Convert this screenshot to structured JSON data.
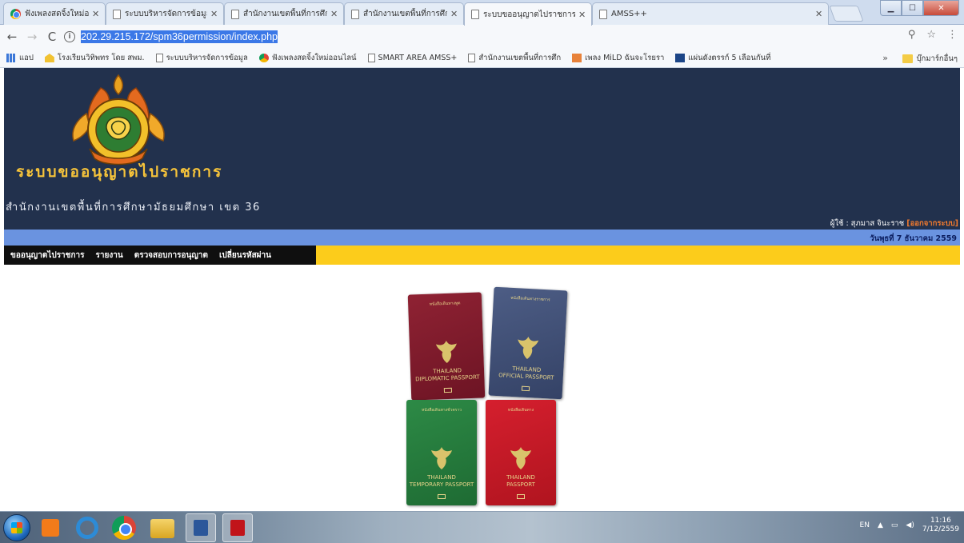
{
  "browser": {
    "tabs": [
      {
        "title": "ฟังเพลงสดจิ้งใหม่ออนไลน์",
        "favicon": "chrome-icon",
        "active": false
      },
      {
        "title": "ระบบบริหารจัดการข้อมูลโรงเรียน",
        "favicon": "document-icon",
        "active": false
      },
      {
        "title": "สำนักงานเขตพื้นที่การศึกษา",
        "favicon": "document-icon",
        "active": false
      },
      {
        "title": "สำนักงานเขตพื้นที่การศึกษา",
        "favicon": "document-icon",
        "active": false
      },
      {
        "title": "ระบบขออนุญาตไปราชการ",
        "favicon": "document-icon",
        "active": true
      },
      {
        "title": "AMSS++",
        "favicon": "document-icon",
        "active": false
      }
    ],
    "url": "202.29.215.172/spm36permission/index.php",
    "bookmarks": [
      {
        "label": "แอป",
        "icon": "apps-icon"
      },
      {
        "label": "โรงเรียนวิทิพทร โดย สพม.",
        "icon": "school-icon"
      },
      {
        "label": "ระบบบริหารจัดการข้อมูล",
        "icon": "document-icon"
      },
      {
        "label": "ฟังเพลงสดจิ้งใหม่ออนไลน์",
        "icon": "chrome-icon"
      },
      {
        "label": "SMART AREA AMSS+",
        "icon": "document-icon"
      },
      {
        "label": "สำนักงานเขตพื้นที่การศึก",
        "icon": "document-icon"
      },
      {
        "label": "เพลง MiLD ฉันจะโรยรา",
        "icon": "music-icon"
      },
      {
        "label": "แผ่นดังตรรก์ 5 เลือนกันที่",
        "icon": "tv-icon"
      }
    ],
    "bookmarks_more": "»",
    "other_bookmarks": "บุ๊กมาร์กอื่นๆ"
  },
  "page": {
    "site_title": "ระบบขออนุญาตไปราชการ",
    "site_subtitle": "สำนักงานเขตพื้นที่การศึกษามัธยมศึกษา เขต 36",
    "user_prefix": "ผู้ใช้ : สุภมาส จินะราช",
    "logout_label": "[ออกจากระบบ]",
    "date": "วันพุธที่ 7 ธันวาคม 2559",
    "menu": [
      "ขออนุญาตไปราชการ",
      "รายงาน",
      "ตรวจสอบการอนุญาต",
      "เปลี่ยนรหัสผ่าน"
    ],
    "passport_covers": [
      {
        "header": "หนังสือเดินทางทูต",
        "footer": "THAILAND\nDIPLOMATIC PASSPORT"
      },
      {
        "header": "หนังสือเดินทางราชการ",
        "footer": "THAILAND\nOFFICIAL PASSPORT"
      },
      {
        "header": "หนังสือเดินทางชั่วคราว",
        "footer": "THAILAND\nTEMPORARY PASSPORT"
      },
      {
        "header": "หนังสือเดินทาง",
        "footer": "THAILAND\nPASSPORT"
      }
    ]
  },
  "taskbar": {
    "language": "EN",
    "time": "11:16",
    "date": "7/12/2559"
  },
  "colors": {
    "header_bg": "#22314d",
    "title_gold": "#f7c43a",
    "band_blue": "#6a93e0",
    "menu_yellow": "#fccc1b",
    "logout_orange": "#f27a2e"
  }
}
